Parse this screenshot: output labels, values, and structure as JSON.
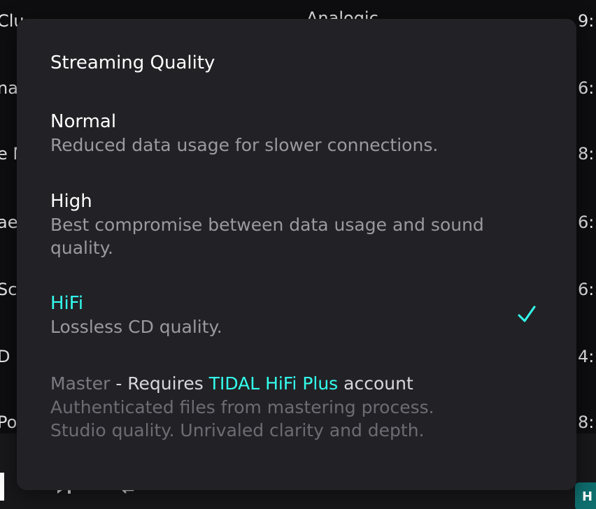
{
  "background": {
    "artist_header": "Analogic",
    "rows": [
      {
        "title": "Clu",
        "time": "9:"
      },
      {
        "title": "nas",
        "time": "6:"
      },
      {
        "title": "e M",
        "time": "8:"
      },
      {
        "title": "ae",
        "time": "6:"
      },
      {
        "title": "Sc",
        "time": "6:"
      },
      {
        "title": "D",
        "time": "4:"
      },
      {
        "title": "Po",
        "time": "8:"
      }
    ],
    "player_chip": "H"
  },
  "dialog": {
    "title": "Streaming Quality",
    "options": [
      {
        "label": "Normal",
        "desc": "Reduced data usage for slower connections."
      },
      {
        "label": "High",
        "desc_line1": "Best compromise between data usage and sound",
        "desc_line2": "quality."
      },
      {
        "label": "HiFi",
        "desc": "Lossless CD quality.",
        "selected": true
      },
      {
        "label": "Master",
        "requirement_prefix": " - Requires ",
        "requirement_link": "TIDAL HiFi Plus",
        "requirement_suffix": " account",
        "desc_line1": "Authenticated files from mastering process.",
        "desc_line2": "Studio quality. Unrivaled clarity and depth.",
        "disabled": true
      }
    ]
  },
  "colors": {
    "accent": "#33ffee",
    "dialog_bg": "#222226",
    "muted_text": "#9a9a9f"
  },
  "icons": {
    "selected": "checkmark-icon",
    "player": [
      "skip-icon",
      "repeat-icon"
    ]
  }
}
